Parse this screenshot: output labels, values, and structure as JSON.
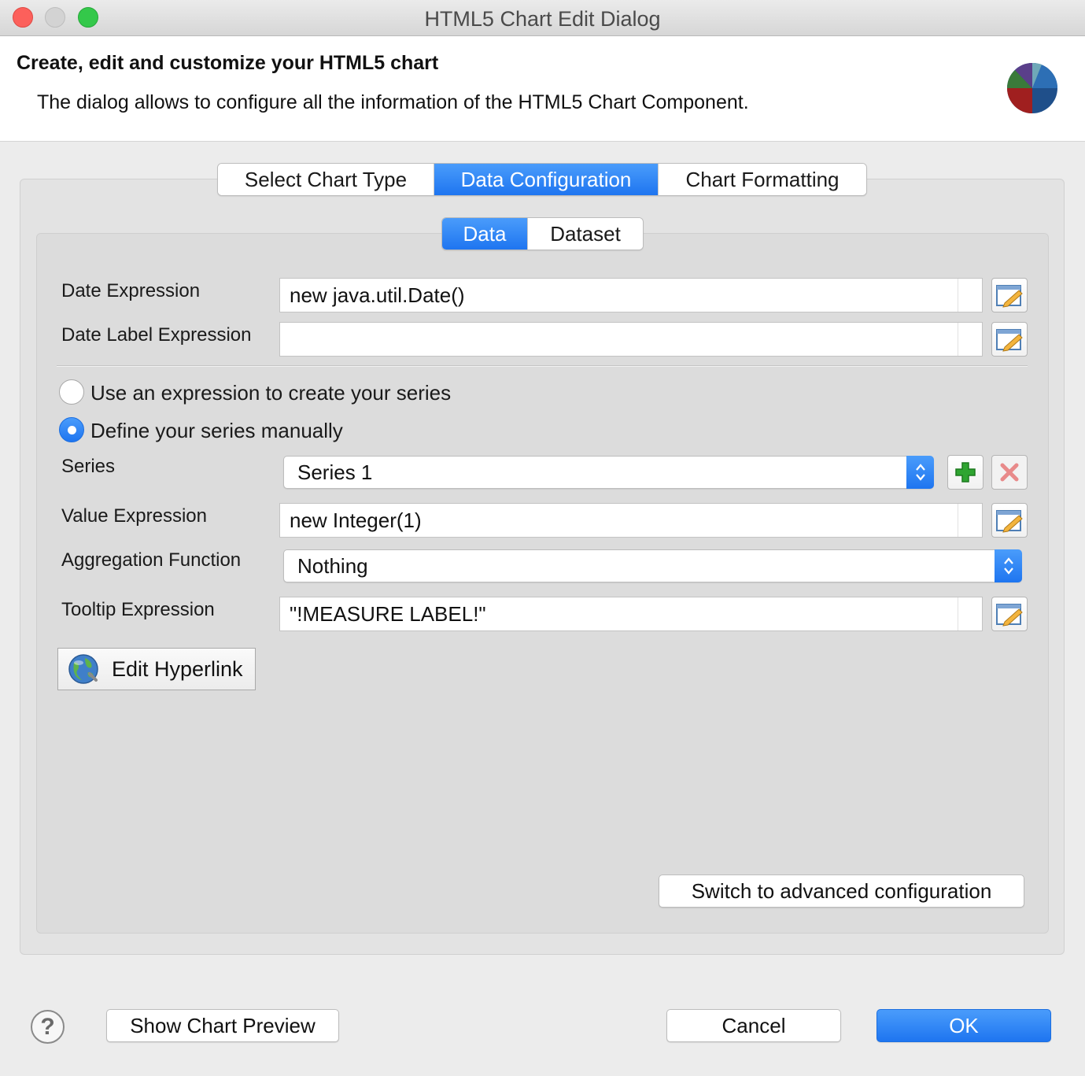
{
  "window": {
    "title": "HTML5 Chart Edit Dialog"
  },
  "header": {
    "title": "Create, edit and customize your HTML5 chart",
    "description": "The dialog allows to configure all the information of the HTML5 Chart Component."
  },
  "main_tabs": [
    {
      "label": "Select Chart Type",
      "active": false
    },
    {
      "label": "Data Configuration",
      "active": true
    },
    {
      "label": "Chart Formatting",
      "active": false
    }
  ],
  "sub_tabs": [
    {
      "label": "Data",
      "active": true
    },
    {
      "label": "Dataset",
      "active": false
    }
  ],
  "form": {
    "date_expression": {
      "label": "Date Expression",
      "value": "new java.util.Date()"
    },
    "date_label_expression": {
      "label": "Date Label Expression",
      "value": ""
    },
    "series_mode": {
      "expression_option": "Use an expression to create your series",
      "manual_option": "Define your series manually",
      "selected": "manual"
    },
    "series": {
      "label": "Series",
      "value": "Series 1"
    },
    "value_expression": {
      "label": "Value Expression",
      "value": "new Integer(1)"
    },
    "aggregation_function": {
      "label": "Aggregation Function",
      "value": "Nothing"
    },
    "tooltip_expression": {
      "label": "Tooltip Expression",
      "value": "\"!MEASURE LABEL!\""
    },
    "edit_hyperlink_label": "Edit Hyperlink",
    "advanced_button_label": "Switch to advanced configuration"
  },
  "footer": {
    "help_icon": "question-mark-icon",
    "preview_label": "Show Chart Preview",
    "cancel_label": "Cancel",
    "ok_label": "OK"
  },
  "colors": {
    "accent": "#1e75f0",
    "add_green": "#2fa531",
    "delete_red": "#e88a8a"
  }
}
